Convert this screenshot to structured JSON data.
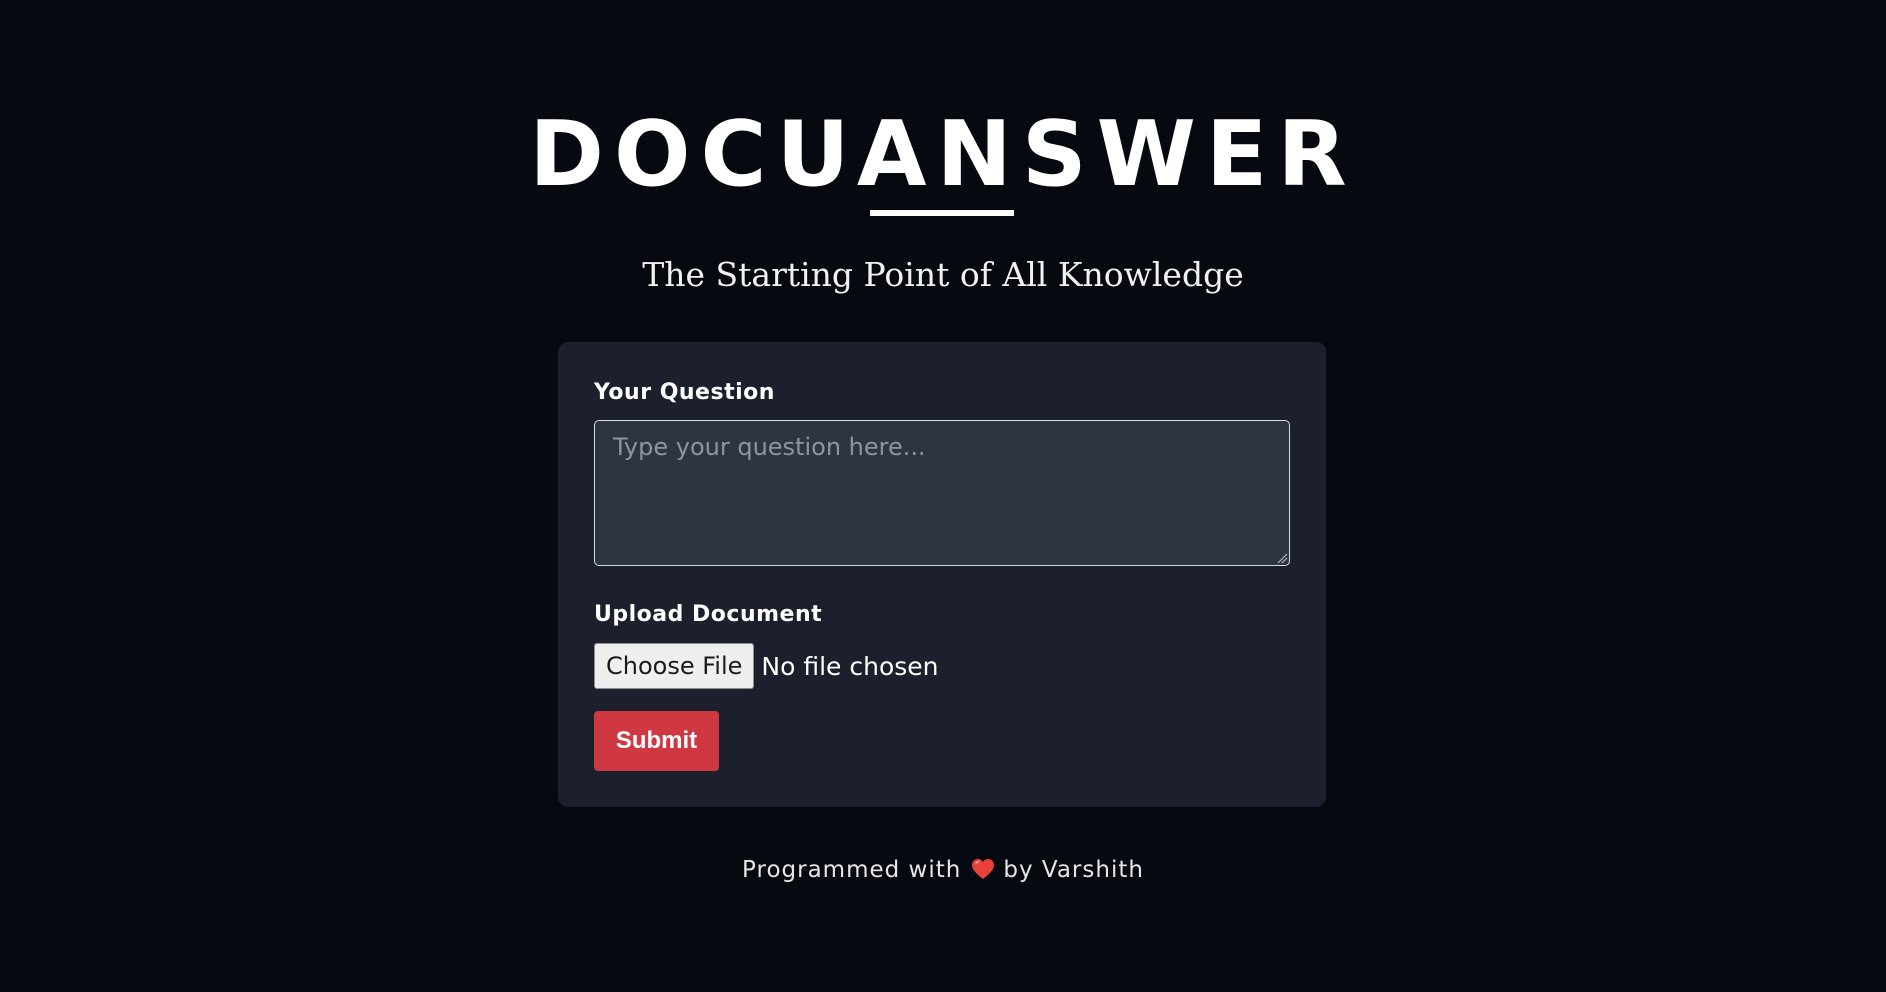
{
  "header": {
    "title": "DOCUANSWER",
    "tagline": "The Starting Point of All Knowledge"
  },
  "form": {
    "question_label": "Your Question",
    "question_placeholder": "Type your question here...",
    "question_value": "",
    "upload_label": "Upload Document",
    "choose_file_label": "Choose File",
    "file_status": "No file chosen",
    "submit_label": "Submit"
  },
  "footer": {
    "prefix": "Programmed with",
    "icon": "heart-icon",
    "suffix": "by Varshith"
  },
  "colors": {
    "background": "#070910",
    "card": "#1c202c",
    "input": "#2d3442",
    "accent": "#cf3841",
    "heart": "#e8413c"
  }
}
